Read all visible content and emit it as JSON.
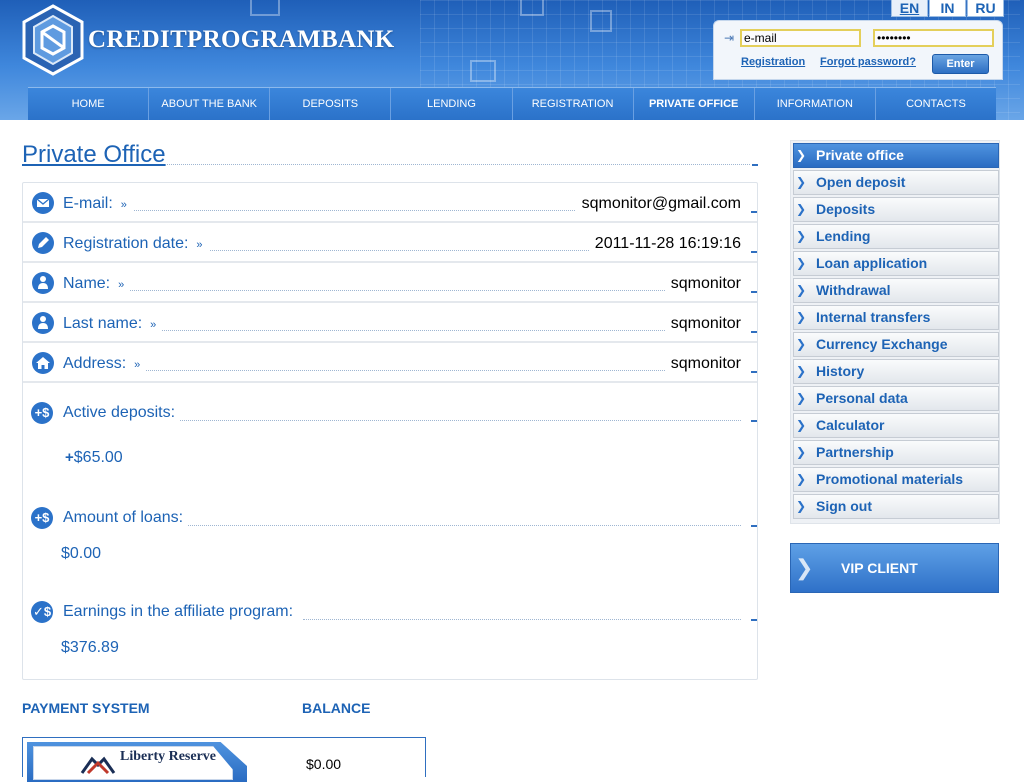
{
  "brand": {
    "name": "CREDITPROGRAMBANK"
  },
  "languages": [
    "EN",
    "IN",
    "RU"
  ],
  "login": {
    "email_value": "e-mail",
    "password_value": "••••••••",
    "registration_link": "Registration",
    "forgot_link": "Forgot password?",
    "enter_label": "Enter"
  },
  "nav": [
    "HOME",
    "ABOUT THE BANK",
    "DEPOSITS",
    "LENDING",
    "REGISTRATION",
    "PRIVATE OFFICE",
    "INFORMATION",
    "CONTACTS"
  ],
  "page_title": "Private Office",
  "profile": [
    {
      "label": "E-mail:",
      "value": "sqmonitor@gmail.com",
      "icon": "envelope-icon"
    },
    {
      "label": "Registration date:",
      "value": "2011-11-28 16:19:16",
      "icon": "pencil-icon"
    },
    {
      "label": "Name:",
      "value": "sqmonitor",
      "icon": "user-icon"
    },
    {
      "label": "Last name:",
      "value": "sqmonitor",
      "icon": "user-icon"
    },
    {
      "label": "Address:",
      "value": "sqmonitor",
      "icon": "home-icon"
    }
  ],
  "summary": {
    "active_deposits": {
      "label": "Active deposits:",
      "amount": "$65.00",
      "plus": "+"
    },
    "loans": {
      "label": "Amount of loans:",
      "amount": "$0.00"
    },
    "affiliate": {
      "label": "Earnings in the affiliate program:",
      "amount": "$376.89"
    }
  },
  "sidebar": [
    "Private office",
    "Open deposit",
    "Deposits",
    "Lending",
    "Loan application",
    "Withdrawal",
    "Internal transfers",
    "Currency Exchange",
    "History",
    "Personal data",
    "Calculator",
    "Partnership",
    "Promotional materials",
    "Sign out"
  ],
  "vip_label": "VIP CLIENT",
  "payment_table": {
    "col_system": "PAYMENT SYSTEM",
    "col_balance": "BALANCE",
    "rows": [
      {
        "system": "Liberty Reserve",
        "balance": "$0.00"
      }
    ]
  },
  "colors": {
    "accent": "#1d63b5",
    "nav": "#2b72c9"
  }
}
